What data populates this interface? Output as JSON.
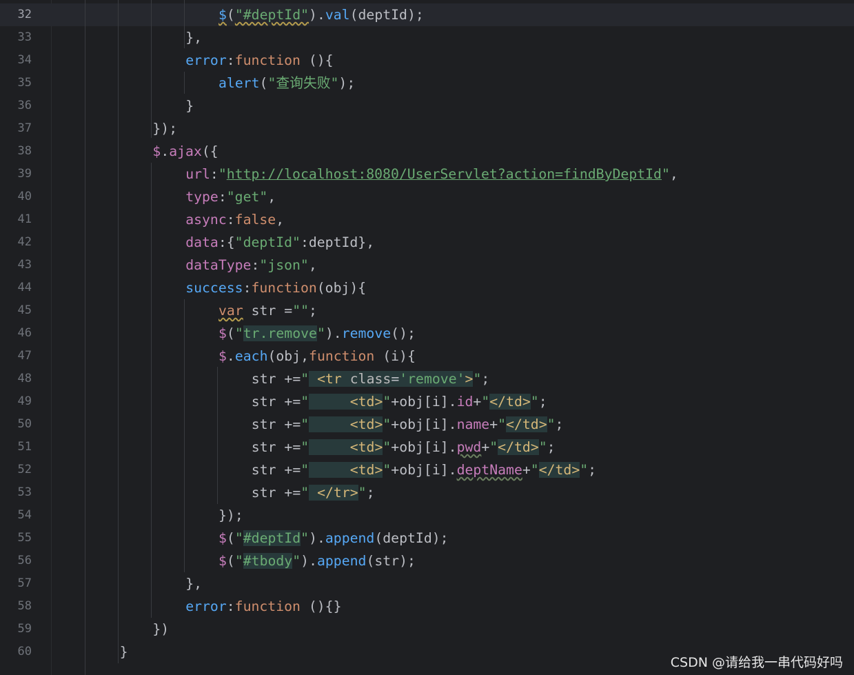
{
  "editor": {
    "current_line": 32,
    "lines": [
      {
        "num": "32",
        "code": "$(\"#deptId\").val(deptId);"
      },
      {
        "num": "33",
        "code": "},"
      },
      {
        "num": "34",
        "code": "error:function (){"
      },
      {
        "num": "35",
        "code": "alert(\"查询失败\");"
      },
      {
        "num": "36",
        "code": "}"
      },
      {
        "num": "37",
        "code": "});"
      },
      {
        "num": "38",
        "code": "$.ajax({"
      },
      {
        "num": "39",
        "code": "url:\"http://localhost:8080/UserServlet?action=findByDeptId\","
      },
      {
        "num": "40",
        "code": "type:\"get\","
      },
      {
        "num": "41",
        "code": "async:false,"
      },
      {
        "num": "42",
        "code": "data:{\"deptId\":deptId},"
      },
      {
        "num": "43",
        "code": "dataType:\"json\","
      },
      {
        "num": "44",
        "code": "success:function(obj){"
      },
      {
        "num": "45",
        "code": "var str =\"\";"
      },
      {
        "num": "46",
        "code": "$(\"tr.remove\").remove();"
      },
      {
        "num": "47",
        "code": "$.each(obj,function (i){"
      },
      {
        "num": "48",
        "code": "str +=\" <tr class='remove'>\";"
      },
      {
        "num": "49",
        "code": "str +=\"     <td>\"+obj[i].id+\"</td>\";"
      },
      {
        "num": "50",
        "code": "str +=\"     <td>\"+obj[i].name+\"</td>\";"
      },
      {
        "num": "51",
        "code": "str +=\"     <td>\"+obj[i].pwd+\"</td>\";"
      },
      {
        "num": "52",
        "code": "str +=\"     <td>\"+obj[i].deptName+\"</td>\";"
      },
      {
        "num": "53",
        "code": "str +=\" </tr>\";"
      },
      {
        "num": "54",
        "code": "});"
      },
      {
        "num": "55",
        "code": "$(\"#deptId\").append(deptId);"
      },
      {
        "num": "56",
        "code": "$(\"#tbody\").append(str);"
      },
      {
        "num": "57",
        "code": "},"
      },
      {
        "num": "58",
        "code": "error:function (){}"
      },
      {
        "num": "59",
        "code": "})"
      },
      {
        "num": "60",
        "code": "}"
      }
    ]
  },
  "watermark": "CSDN @请给我一串代码好吗",
  "colors": {
    "background": "#1e1f22",
    "keyword": "#cf8e6d",
    "function": "#56a8f5",
    "property": "#c77dbb",
    "string": "#6aab73",
    "html_tag": "#d5b778",
    "injected_html_bg": "#283a3b"
  }
}
